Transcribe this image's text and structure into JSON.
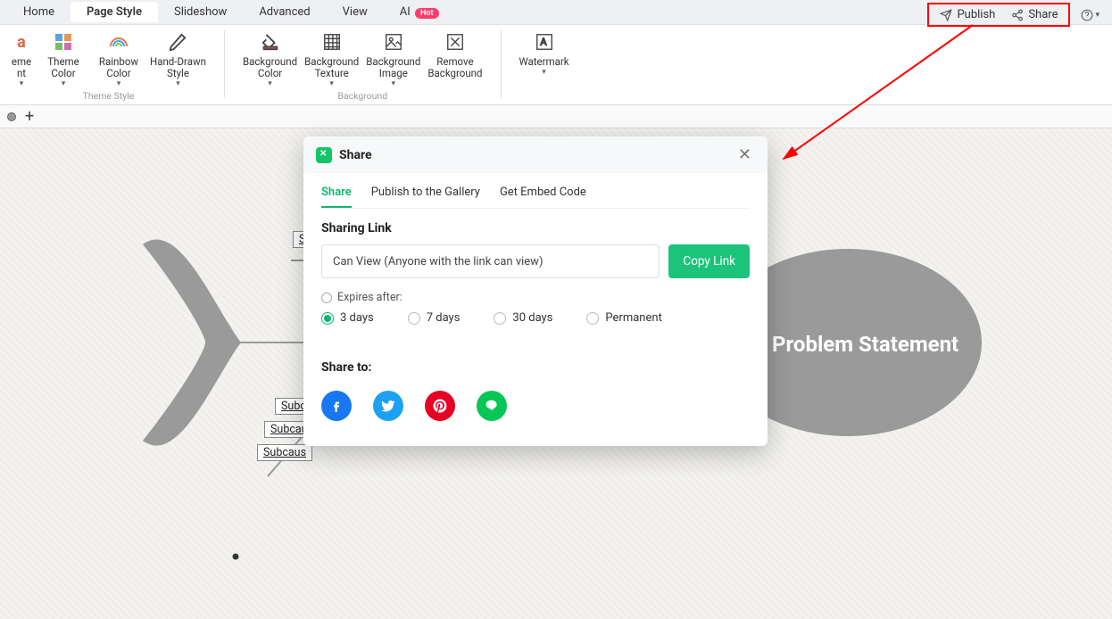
{
  "tabs": {
    "items": [
      "Home",
      "Page Style",
      "Slideshow",
      "Advanced",
      "View",
      "AI"
    ],
    "activeIndex": 1,
    "hotLabel": "Hot"
  },
  "topRight": {
    "publish": "Publish",
    "share": "Share"
  },
  "ribbon": {
    "themeStyle": {
      "groupLabel": "Theme Style",
      "items": [
        {
          "label": "eme\nnt",
          "dropdown": true
        },
        {
          "label": "Theme\nColor",
          "dropdown": true
        },
        {
          "label": "Rainbow\nColor",
          "dropdown": true
        },
        {
          "label": "Hand-Drawn\nStyle",
          "dropdown": true
        }
      ]
    },
    "background": {
      "groupLabel": "Background",
      "items": [
        {
          "label": "Background\nColor",
          "dropdown": true
        },
        {
          "label": "Background\nTexture",
          "dropdown": true
        },
        {
          "label": "Background\nImage",
          "dropdown": true
        },
        {
          "label": "Remove\nBackground",
          "dropdown": false
        }
      ]
    },
    "watermark": {
      "items": [
        {
          "label": "Watermark",
          "dropdown": true
        }
      ]
    }
  },
  "canvas": {
    "problemStatement": "Problem Statement",
    "subcauses": [
      "S",
      "Subc",
      "Subcau",
      "Subcaus"
    ]
  },
  "modal": {
    "title": "Share",
    "tabs": [
      "Share",
      "Publish to the Gallery",
      "Get Embed Code"
    ],
    "activeTab": 0,
    "sharingLinkTitle": "Sharing Link",
    "permissionValue": "Can View (Anyone with the link can view)",
    "copyBtn": "Copy Link",
    "expiresLabel": "Expires after:",
    "expireOptions": [
      "3 days",
      "7 days",
      "30 days",
      "Permanent"
    ],
    "expireSelected": 0,
    "shareToTitle": "Share to:",
    "social": {
      "facebook": "facebook",
      "twitter": "twitter",
      "pinterest": "pinterest",
      "line": "line"
    }
  }
}
